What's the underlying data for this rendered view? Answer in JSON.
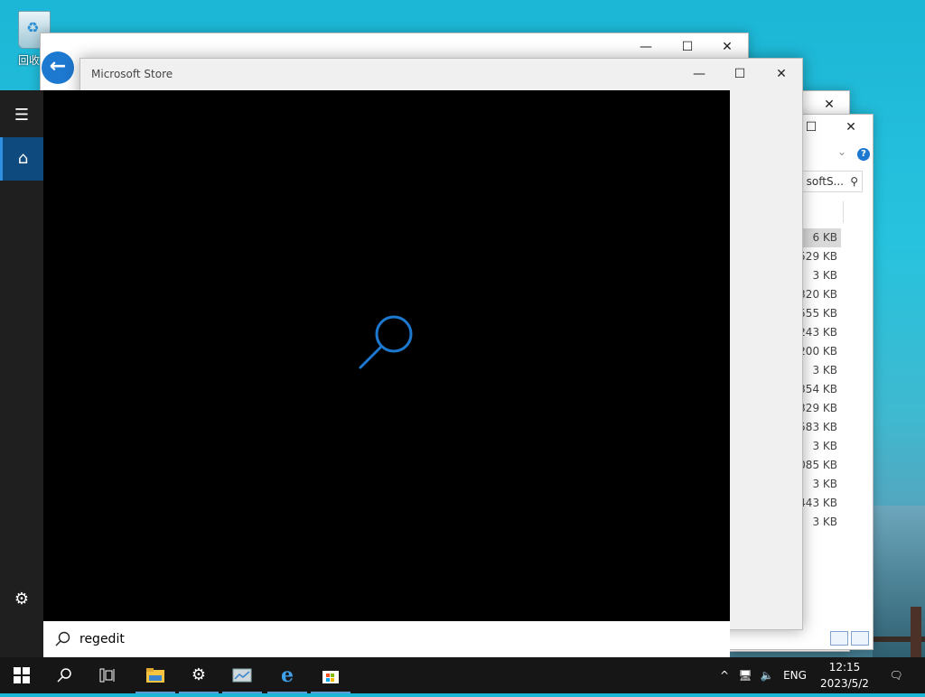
{
  "desktop": {
    "recycle_bin_label": "回收"
  },
  "store_window": {
    "title": "Microsoft Store",
    "minimize": "—",
    "maximize": "☐",
    "close": "✕"
  },
  "back_window": {
    "minimize": "—",
    "maximize": "☐",
    "close": "✕",
    "back_arrow": "←"
  },
  "explorer_window": {
    "maximize": "☐",
    "close": "✕",
    "help": "?",
    "search_text": "softS...",
    "file_sizes": [
      "6 KB",
      "529 KB",
      "3 KB",
      "320 KB",
      "555 KB",
      "243 KB",
      "200 KB",
      "3 KB",
      "354 KB",
      "329 KB",
      "583 KB",
      "3 KB",
      "085 KB",
      "3 KB",
      "443 KB",
      "3 KB"
    ]
  },
  "start_search": {
    "query": "regedit",
    "accent": "#1d78d0"
  },
  "taskbar": {
    "language": "ENG",
    "time": "12:15",
    "date": "2023/5/2"
  }
}
